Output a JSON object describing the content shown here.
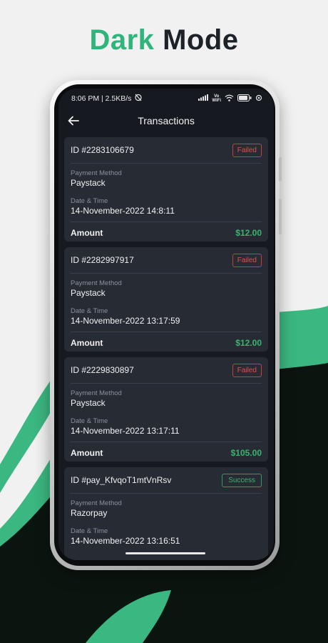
{
  "hero": {
    "title_accent": "Dark",
    "title_rest": "Mode"
  },
  "status_bar": {
    "text": "8:06 PM | 2.5KB/s",
    "vowifi_top": "Vo",
    "vowifi_bottom": "WiFi"
  },
  "app_bar": {
    "title": "Transactions"
  },
  "labels": {
    "payment_method": "Payment Method",
    "date_time": "Date & Time",
    "amount": "Amount"
  },
  "transactions": [
    {
      "id": "ID #2283106679",
      "status": "Failed",
      "payment_method": "Paystack",
      "date_time": "14-November-2022 14:8:11",
      "amount": "$12.00"
    },
    {
      "id": "ID #2282997917",
      "status": "Failed",
      "payment_method": "Paystack",
      "date_time": "14-November-2022 13:17:59",
      "amount": "$12.00"
    },
    {
      "id": "ID #2229830897",
      "status": "Failed",
      "payment_method": "Paystack",
      "date_time": "14-November-2022 13:17:11",
      "amount": "$105.00"
    },
    {
      "id": "ID #pay_KfvqoT1mtVnRsv",
      "status": "Success",
      "payment_method": "Razorpay",
      "date_time": "14-November-2022 13:16:51"
    }
  ],
  "colors": {
    "accent": "#2fb57c",
    "dark_bg": "#0b1510",
    "card": "#262b34",
    "failed": "#e34d4d",
    "success": "#39b56f"
  }
}
